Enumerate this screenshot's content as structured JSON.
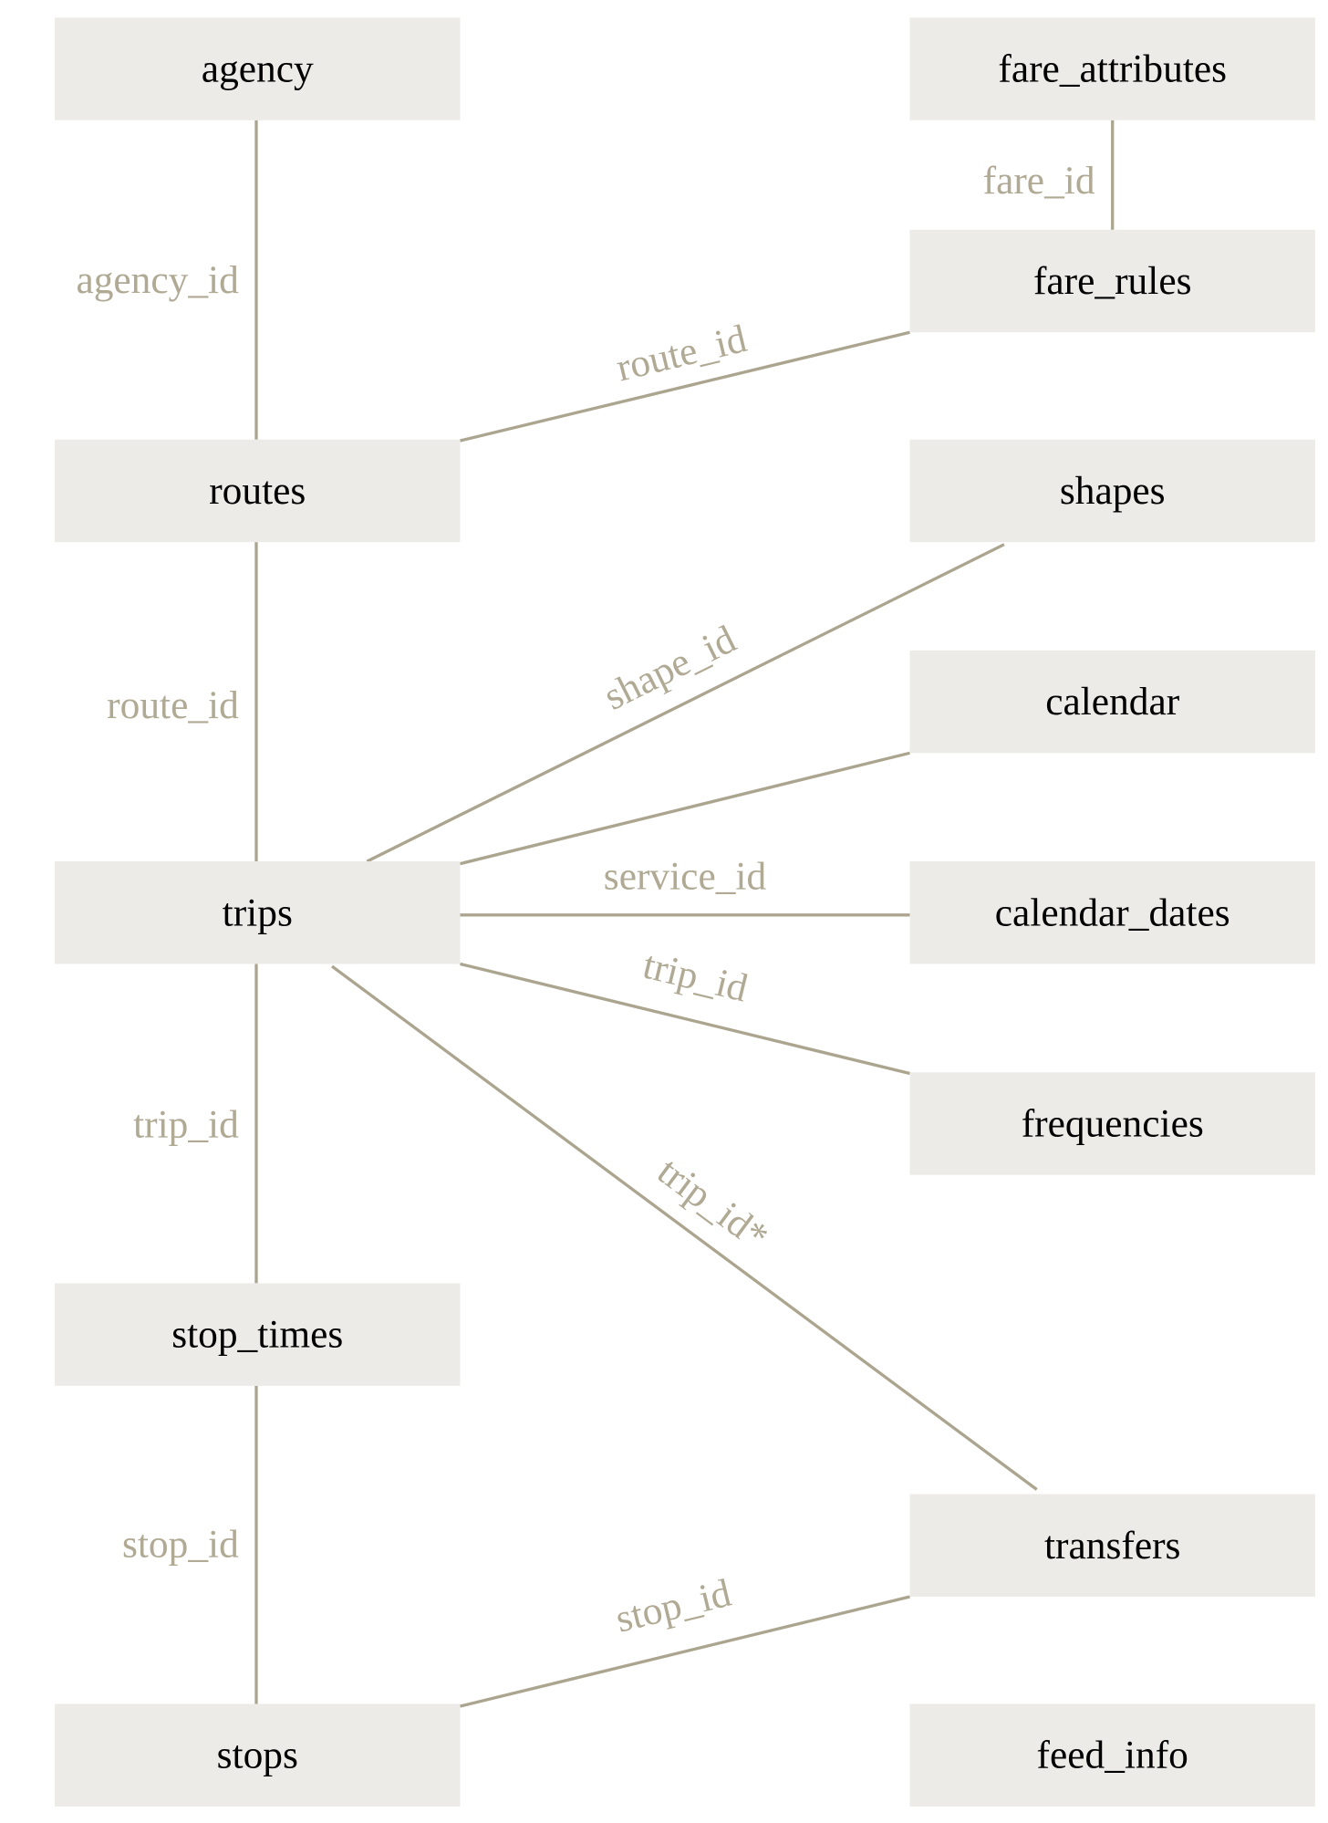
{
  "colors": {
    "box_fill": "#edebe7",
    "edge": "#aba58f",
    "edge_label": "#b0a994",
    "node_text": "#000000"
  },
  "nodes": [
    {
      "id": "agency",
      "label": "agency"
    },
    {
      "id": "routes",
      "label": "routes"
    },
    {
      "id": "trips",
      "label": "trips"
    },
    {
      "id": "stop_times",
      "label": "stop_times"
    },
    {
      "id": "stops",
      "label": "stops"
    },
    {
      "id": "fare_attributes",
      "label": "fare_attributes"
    },
    {
      "id": "fare_rules",
      "label": "fare_rules"
    },
    {
      "id": "shapes",
      "label": "shapes"
    },
    {
      "id": "calendar",
      "label": "calendar"
    },
    {
      "id": "calendar_dates",
      "label": "calendar_dates"
    },
    {
      "id": "frequencies",
      "label": "frequencies"
    },
    {
      "id": "transfers",
      "label": "transfers"
    },
    {
      "id": "feed_info",
      "label": "feed_info"
    }
  ],
  "edges": [
    {
      "from": "agency",
      "to": "routes",
      "label": "agency_id"
    },
    {
      "from": "fare_attributes",
      "to": "fare_rules",
      "label": "fare_id"
    },
    {
      "from": "routes",
      "to": "fare_rules",
      "label": "route_id"
    },
    {
      "from": "routes",
      "to": "trips",
      "label": "route_id"
    },
    {
      "from": "trips",
      "to": "shapes",
      "label": "shape_id"
    },
    {
      "from": "trips",
      "to": "calendar",
      "label": ""
    },
    {
      "from": "trips",
      "to": "calendar_dates",
      "label": "service_id"
    },
    {
      "from": "trips",
      "to": "frequencies",
      "label": "trip_id"
    },
    {
      "from": "trips",
      "to": "transfers",
      "label": "trip_id*"
    },
    {
      "from": "trips",
      "to": "stop_times",
      "label": "trip_id"
    },
    {
      "from": "stop_times",
      "to": "stops",
      "label": "stop_id"
    },
    {
      "from": "stops",
      "to": "transfers",
      "label": "stop_id"
    }
  ]
}
